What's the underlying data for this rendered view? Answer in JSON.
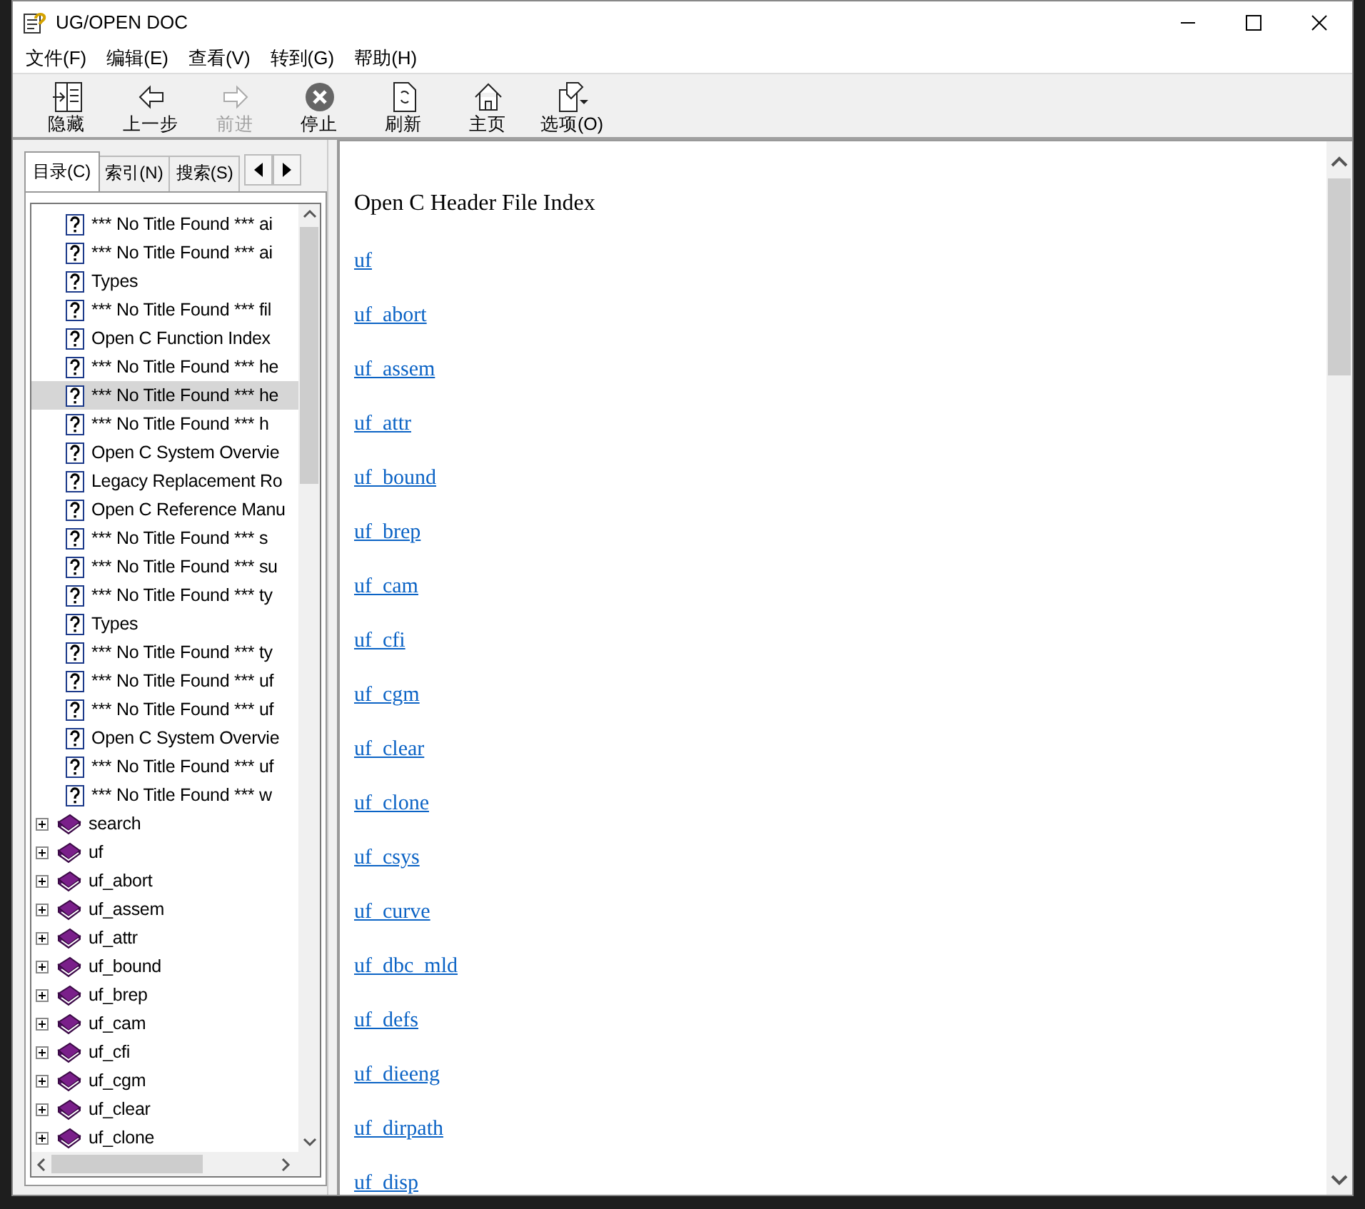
{
  "window": {
    "title": "UG/OPEN DOC"
  },
  "menu": [
    "文件(F)",
    "编辑(E)",
    "查看(V)",
    "转到(G)",
    "帮助(H)"
  ],
  "toolbar": [
    {
      "kind": "hide",
      "label": "隐藏",
      "disabled": false
    },
    {
      "kind": "back",
      "label": "上一步",
      "disabled": false
    },
    {
      "kind": "forward",
      "label": "前进",
      "disabled": true
    },
    {
      "kind": "stop",
      "label": "停止",
      "disabled": false
    },
    {
      "kind": "refresh",
      "label": "刷新",
      "disabled": false
    },
    {
      "kind": "home",
      "label": "主页",
      "disabled": false
    },
    {
      "kind": "options",
      "label": "选项(O)",
      "disabled": false
    }
  ],
  "tabs": [
    {
      "label": "目录(C)",
      "selected": true
    },
    {
      "label": "索引(N)",
      "selected": false
    },
    {
      "label": "搜索(S)",
      "selected": false
    }
  ],
  "tree": [
    {
      "kind": "page",
      "label": "*** No Title Found *** ai",
      "selected": false
    },
    {
      "kind": "page",
      "label": "*** No Title Found *** ai",
      "selected": false
    },
    {
      "kind": "page",
      "label": "Types",
      "selected": false
    },
    {
      "kind": "page",
      "label": "*** No Title Found *** fil",
      "selected": false
    },
    {
      "kind": "page",
      "label": "Open C Function Index",
      "selected": false
    },
    {
      "kind": "page",
      "label": "*** No Title Found *** he",
      "selected": false
    },
    {
      "kind": "page",
      "label": "*** No Title Found *** he",
      "selected": true
    },
    {
      "kind": "page",
      "label": "*** No Title Found *** h",
      "selected": false
    },
    {
      "kind": "page",
      "label": "Open C System Overvie",
      "selected": false
    },
    {
      "kind": "page",
      "label": "Legacy Replacement Ro",
      "selected": false
    },
    {
      "kind": "page",
      "label": "Open C Reference Manu",
      "selected": false
    },
    {
      "kind": "page",
      "label": "*** No Title Found *** s",
      "selected": false
    },
    {
      "kind": "page",
      "label": "*** No Title Found *** su",
      "selected": false
    },
    {
      "kind": "page",
      "label": "*** No Title Found *** ty",
      "selected": false
    },
    {
      "kind": "page",
      "label": "Types",
      "selected": false
    },
    {
      "kind": "page",
      "label": "*** No Title Found *** ty",
      "selected": false
    },
    {
      "kind": "page",
      "label": "*** No Title Found *** uf",
      "selected": false
    },
    {
      "kind": "page",
      "label": "*** No Title Found *** uf",
      "selected": false
    },
    {
      "kind": "page",
      "label": "Open C System Overvie",
      "selected": false
    },
    {
      "kind": "page",
      "label": "*** No Title Found *** uf",
      "selected": false
    },
    {
      "kind": "page",
      "label": "*** No Title Found *** w",
      "selected": false
    },
    {
      "kind": "book",
      "label": "search",
      "expanded": false,
      "selected": false
    },
    {
      "kind": "book",
      "label": "uf",
      "expanded": false,
      "selected": false
    },
    {
      "kind": "book",
      "label": "uf_abort",
      "expanded": false,
      "selected": false
    },
    {
      "kind": "book",
      "label": "uf_assem",
      "expanded": false,
      "selected": false
    },
    {
      "kind": "book",
      "label": "uf_attr",
      "expanded": false,
      "selected": false
    },
    {
      "kind": "book",
      "label": "uf_bound",
      "expanded": false,
      "selected": false
    },
    {
      "kind": "book",
      "label": "uf_brep",
      "expanded": false,
      "selected": false
    },
    {
      "kind": "book",
      "label": "uf_cam",
      "expanded": false,
      "selected": false
    },
    {
      "kind": "book",
      "label": "uf_cfi",
      "expanded": false,
      "selected": false
    },
    {
      "kind": "book",
      "label": "uf_cgm",
      "expanded": false,
      "selected": false
    },
    {
      "kind": "book",
      "label": "uf_clear",
      "expanded": false,
      "selected": false
    },
    {
      "kind": "book",
      "label": "uf_clone",
      "expanded": false,
      "selected": false
    }
  ],
  "content": {
    "heading": "Open C Header File Index",
    "links": [
      "uf",
      "uf_abort",
      "uf_assem",
      "uf_attr",
      "uf_bound",
      "uf_brep",
      "uf_cam",
      "uf_cfi",
      "uf_cgm",
      "uf_clear",
      "uf_clone",
      "uf_csys",
      "uf_curve",
      "uf_dbc_mld",
      "uf_defs",
      "uf_dieeng",
      "uf_dirpath",
      "uf_disp"
    ]
  }
}
